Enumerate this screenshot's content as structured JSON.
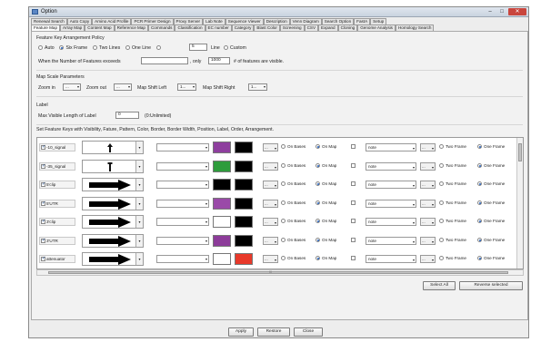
{
  "window": {
    "title": "Option",
    "controls": {
      "minimize": "–",
      "maximize": "□",
      "close": "✕"
    }
  },
  "tabs_row1": [
    "Renewal Search",
    "Auto Copy",
    "Amino Acid Profile",
    "PCR Primer Design",
    "Proxy Server",
    "Lab Note",
    "Sequence Viewer",
    "Description",
    "Venn Diagram",
    "Search Option",
    "FastA",
    "Setup"
  ],
  "tabs_row2": [
    "Feature Map",
    "Array Map",
    "Content Map",
    "Reference Map",
    "Commands",
    "Classification",
    "EC number",
    "Category",
    "Blast Color",
    "Screening",
    "CSV",
    "Expand",
    "Cloning",
    "Genome Analysis",
    "Homology Search"
  ],
  "active_tab": "Feature Map",
  "arrangement": {
    "heading": "Feature Key Arrangement Policy",
    "options": [
      "Auto",
      "Six Frame",
      "Two Lines",
      "One Line"
    ],
    "selected": "Six Frame",
    "lines_value": "5",
    "lines_label": "Line",
    "custom_label": "Custom",
    "exceed_label": "When the Number of Features exceeds",
    "exceed_value": "",
    "only_label": ", only",
    "only_value": "1000",
    "visible_suffix": "# of features are visible."
  },
  "map_scale": {
    "heading": "Map Scale Parameters",
    "zoom_in_label": "Zoom in",
    "zoom_in_value": "...",
    "zoom_out_label": "Zoom out",
    "zoom_out_value": "...",
    "shift_left_label": "Map Shift Left",
    "shift_left_value": "1...",
    "shift_right_label": "Map Shift Right",
    "shift_right_value": "1..."
  },
  "label": {
    "heading": "Label",
    "max_len_label": "Max Visible Length of Label",
    "max_len_value": "0",
    "unlimited_note": "(0:Unlimited)"
  },
  "feature_keys": {
    "heading": "Set Feature Keys with Visibility, Fature, Pattern, Color, Border, Border Width, Position, Label, Order, Arrangement.",
    "on_bases": "On Bases",
    "on_map": "On Map",
    "two_frame": "Two Frame",
    "one_frame": "One Frame",
    "rows": [
      {
        "name": "-10_signal",
        "shape": "up-arrow-icon",
        "color": "#8e3f9e",
        "border": "#000000",
        "sel": "...",
        "note": "note",
        "checked": true
      },
      {
        "name": "-35_signal",
        "shape": "pin-icon",
        "color": "#2e9c3c",
        "border": "#000000",
        "sel": "...",
        "note": "note",
        "checked": true
      },
      {
        "name": "5'clip",
        "shape": "arrow-right-icon",
        "color": "#000000",
        "border": "#000000",
        "sel": "...",
        "note": "note",
        "checked": true
      },
      {
        "name": "5'UTR",
        "shape": "arrow-right-icon",
        "color": "#9a4aa8",
        "border": "#000000",
        "sel": "...",
        "note": "note",
        "checked": true
      },
      {
        "name": "3'clip",
        "shape": "arrow-right-icon",
        "color": "#ffffff",
        "border": "#000000",
        "sel": "...",
        "note": "note",
        "checked": true
      },
      {
        "name": "3'UTR",
        "shape": "arrow-right-icon",
        "color": "#8d3c9a",
        "border": "#000000",
        "sel": "...",
        "note": "note",
        "checked": true
      },
      {
        "name": "attenuator",
        "shape": "arrow-right-icon",
        "color": "#ffffff",
        "border": "#e8392a",
        "sel": "...",
        "note": "note",
        "checked": true
      }
    ]
  },
  "buttons": {
    "select_all": "Select All",
    "reverse_selected": "Reverse selected",
    "apply": "Apply",
    "restore": "Restore",
    "close": "Close"
  },
  "hscroll_marker": "III"
}
